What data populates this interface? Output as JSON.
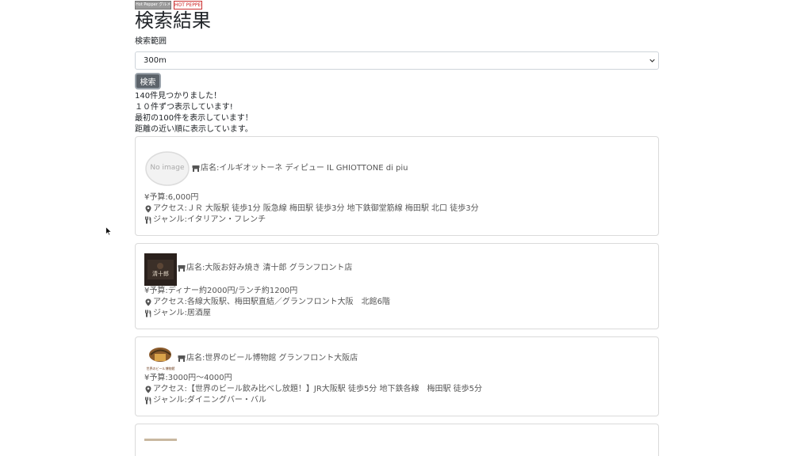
{
  "logos": {
    "left_text": "Hot Pepper グルメ 提供",
    "right_text": "HOT PEPPER"
  },
  "title": "検索結果",
  "range": {
    "label": "検索範囲",
    "selected": "300m"
  },
  "search_button": "検索",
  "info_lines": [
    "140件見つかりました！",
    "１０件ずつ表示しています!",
    "最初の100件を表示しています！",
    "距離の近い順に表示しています。"
  ],
  "no_image_text": "No image",
  "thumb2_text": "清十郎",
  "thumb3_text": "世界のビール博物館",
  "shops": [
    {
      "name": "店名:イルギオットーネ ディピュー IL GHIOTTONE di piu",
      "budget": "¥予算:6,000円",
      "access": "アクセス:ＪＲ 大阪駅 徒歩1分 阪急線 梅田駅 徒歩3分 地下鉄御堂筋線 梅田駅 北口 徒歩3分",
      "genre": "ジャンル:イタリアン・フレンチ"
    },
    {
      "name": "店名:大阪お好み焼き 清十郎 グランフロント店",
      "budget": "¥予算:ディナー約2000円/ランチ約1200円",
      "access": "アクセス:各線大阪駅、梅田駅直結／グランフロント大阪　北館6階",
      "genre": "ジャンル:居酒屋"
    },
    {
      "name": "店名:世界のビール博物館 グランフロント大阪店",
      "budget": "¥予算:3000円～4000円",
      "access": "アクセス:【世界のビール飲み比べし放題！】JR大阪駅 徒歩5分 地下鉄各線　梅田駅 徒歩5分",
      "genre": "ジャンル:ダイニングバー・バル"
    }
  ]
}
